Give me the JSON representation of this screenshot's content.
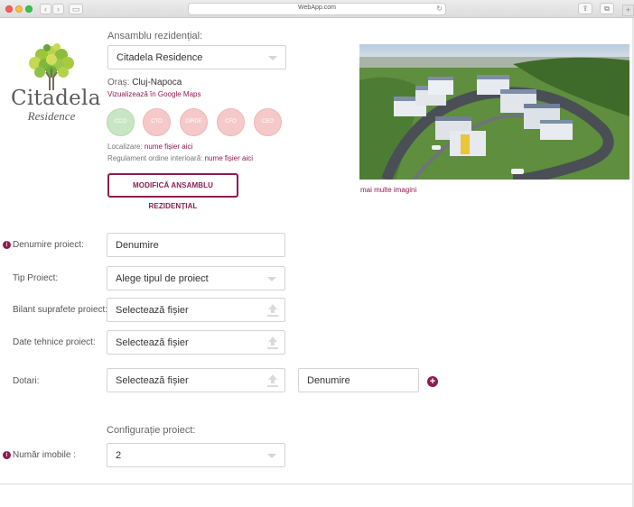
{
  "browser": {
    "url": "WebApp.com"
  },
  "brand": {
    "name": "Citadela",
    "subtitle": "Residence"
  },
  "ensemble": {
    "label": "Ansamblu rezidențial:",
    "selected": "Citadela Residence",
    "city_label": "Oraș:",
    "city_value": "Cluj-Napoca",
    "maps_link": "Vizualizează în Google Maps",
    "energy_badges": [
      {
        "label": "CCO",
        "active": true
      },
      {
        "label": "CTO",
        "active": false
      },
      {
        "label": "DIRDE",
        "active": false
      },
      {
        "label": "CFO",
        "active": false
      },
      {
        "label": "CEO",
        "active": false
      }
    ],
    "location_label": "Localizare:",
    "location_link": "nume fișier aici",
    "rules_label": "Regulament ordine interioară:",
    "rules_link": "nume fișier aici",
    "modify_button": "MODIFICĂ ANSAMBLU REZIDENȚIAL",
    "more_images": "mai multe imagini"
  },
  "form": {
    "project_name_label": "Denumire proiect:",
    "project_name_placeholder": "Denumire",
    "project_type_label": "Tip Proiect:",
    "project_type_value": "Alege tipul de proiect",
    "surface_label": "Bilant suprafete proiect:",
    "surface_value": "Selectează fișier",
    "tech_label": "Date tehnice proiect:",
    "tech_value": "Selectează fișier",
    "dotari_label": "Dotari:",
    "dotari_file": "Selectează fișier",
    "dotari_name": "Denumire",
    "config_heading": "Configurație proiect:",
    "buildings_label": "Număr imobile :",
    "buildings_value": "2"
  },
  "colors": {
    "accent": "#8d1b52",
    "energy_active": "#c8e6c3",
    "energy_inactive": "#f5c9c9"
  },
  "icons": {
    "info": "info-icon",
    "upload": "upload-icon",
    "plus": "plus-circle-icon",
    "caret": "chevron-down-icon"
  }
}
